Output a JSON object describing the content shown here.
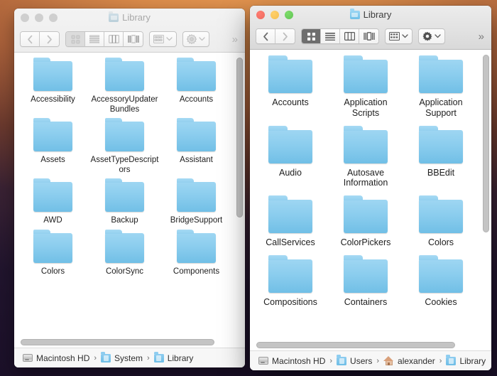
{
  "desktop": {
    "wallpaper_top_color": "#f0a257",
    "wallpaper_bottom_color": "#241730"
  },
  "windows": [
    {
      "id": "system-library-window",
      "state": "inactive",
      "title": "Library",
      "title_icon": "folder-icon",
      "traffic_lights": {
        "close_label": "Close",
        "minimize_label": "Minimize",
        "maximize_label": "Zoom",
        "close_color": "#cfcfcf",
        "minimize_color": "#cfcfcf",
        "maximize_color": "#cfcfcf"
      },
      "toolbar": {
        "back_icon": "chevron-left-icon",
        "forward_icon": "chevron-right-icon",
        "view_modes": [
          {
            "name": "icon-view",
            "icon": "grid-icon",
            "selected": true
          },
          {
            "name": "list-view",
            "icon": "list-icon",
            "selected": false
          },
          {
            "name": "column-view",
            "icon": "columns-icon",
            "selected": false
          },
          {
            "name": "gallery-view",
            "icon": "gallery-icon",
            "selected": false
          }
        ],
        "arrange_icon": "arrange-icon",
        "arrange_chevron": "chevron-down-icon",
        "action_icon": "gear-icon",
        "action_chevron": "chevron-down-icon",
        "overflow_label": "»"
      },
      "scroll": {
        "vertical_thumb_top_pct": 1,
        "vertical_thumb_height_pct": 55,
        "horizontal_thumb_left_pct": 1,
        "horizontal_thumb_width_pct": 90
      },
      "items": [
        {
          "name": "Accessibility",
          "icon": "folder-icon"
        },
        {
          "name": "AccessoryUpdaterBundles",
          "icon": "folder-icon"
        },
        {
          "name": "Accounts",
          "icon": "folder-icon"
        },
        {
          "name": "Assets",
          "icon": "folder-icon"
        },
        {
          "name": "AssetTypeDescriptors",
          "icon": "folder-icon"
        },
        {
          "name": "Assistant",
          "icon": "folder-icon"
        },
        {
          "name": "AWD",
          "icon": "folder-icon"
        },
        {
          "name": "Backup",
          "icon": "folder-icon"
        },
        {
          "name": "BridgeSupport",
          "icon": "folder-icon"
        },
        {
          "name": "Colors",
          "icon": "folder-icon"
        },
        {
          "name": "ColorSync",
          "icon": "folder-icon"
        },
        {
          "name": "Components",
          "icon": "folder-icon"
        }
      ],
      "path_bar": [
        {
          "label": "Macintosh HD",
          "icon": "hard-drive-icon"
        },
        {
          "label": "System",
          "icon": "folder-icon"
        },
        {
          "label": "Library",
          "icon": "folder-icon"
        }
      ],
      "path_separator": "›"
    },
    {
      "id": "user-library-window",
      "state": "active",
      "title": "Library",
      "title_icon": "folder-icon",
      "traffic_lights": {
        "close_label": "Close",
        "minimize_label": "Minimize",
        "maximize_label": "Zoom",
        "close_color": "#ed6a5e",
        "minimize_color": "#f5bf4f",
        "maximize_color": "#61c454"
      },
      "toolbar": {
        "back_icon": "chevron-left-icon",
        "forward_icon": "chevron-right-icon",
        "view_modes": [
          {
            "name": "icon-view",
            "icon": "grid-icon",
            "selected": true
          },
          {
            "name": "list-view",
            "icon": "list-icon",
            "selected": false
          },
          {
            "name": "column-view",
            "icon": "columns-icon",
            "selected": false
          },
          {
            "name": "gallery-view",
            "icon": "gallery-icon",
            "selected": false
          }
        ],
        "arrange_icon": "arrange-icon",
        "arrange_chevron": "chevron-down-icon",
        "action_icon": "gear-icon",
        "action_chevron": "chevron-down-icon",
        "overflow_label": "»"
      },
      "scroll": {
        "vertical_thumb_top_pct": 1,
        "vertical_thumb_height_pct": 60,
        "horizontal_thumb_left_pct": 1,
        "horizontal_thumb_width_pct": 88
      },
      "items": [
        {
          "name": "Accounts",
          "icon": "folder-icon"
        },
        {
          "name": "Application Scripts",
          "icon": "folder-icon"
        },
        {
          "name": "Application Support",
          "icon": "folder-icon"
        },
        {
          "name": "Audio",
          "icon": "folder-icon"
        },
        {
          "name": "Autosave Information",
          "icon": "folder-icon"
        },
        {
          "name": "BBEdit",
          "icon": "folder-icon"
        },
        {
          "name": "CallServices",
          "icon": "folder-icon"
        },
        {
          "name": "ColorPickers",
          "icon": "folder-icon"
        },
        {
          "name": "Colors",
          "icon": "folder-icon"
        },
        {
          "name": "Compositions",
          "icon": "folder-icon"
        },
        {
          "name": "Containers",
          "icon": "folder-icon"
        },
        {
          "name": "Cookies",
          "icon": "folder-icon"
        }
      ],
      "path_bar": [
        {
          "label": "Macintosh HD",
          "icon": "hard-drive-icon"
        },
        {
          "label": "Users",
          "icon": "folder-icon"
        },
        {
          "label": "alexander",
          "icon": "home-icon"
        },
        {
          "label": "Library",
          "icon": "folder-icon"
        }
      ],
      "path_separator": "›"
    }
  ]
}
